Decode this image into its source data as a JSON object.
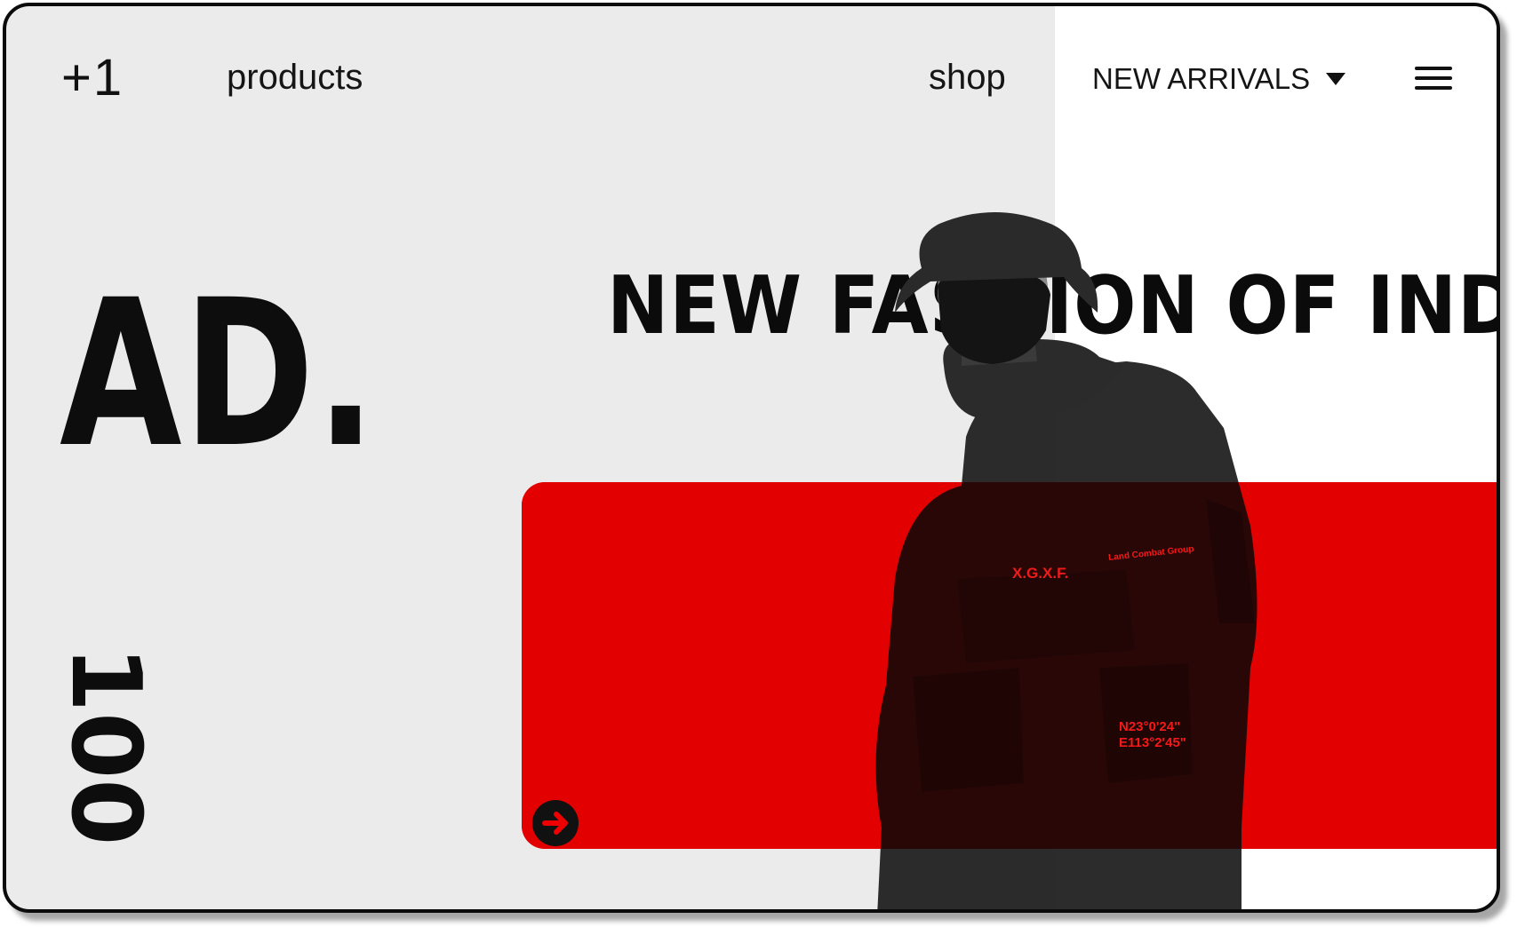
{
  "header": {
    "logo": "+1",
    "nav": {
      "products": "products",
      "shop": "shop"
    },
    "dropdown": {
      "label": "NEW ARRIVALS"
    }
  },
  "hero": {
    "big_text": "AD.",
    "vertical_number": "100",
    "headline": "NEW FASHION OF IND."
  },
  "jacket_print": {
    "brand": "X.G.X.F.",
    "patch_title": "Land Combat Group",
    "coord_line_1": "N23°0'24\"",
    "coord_line_2": "E113°2'45\""
  },
  "colors": {
    "background": "#ebebeb",
    "panel": "#ffffff",
    "accent_red": "#ee0000",
    "text": "#111111"
  },
  "icons": {
    "menu": "hamburger-menu-icon",
    "dropdown": "caret-down-icon",
    "cta": "arrow-right-circle-icon"
  }
}
